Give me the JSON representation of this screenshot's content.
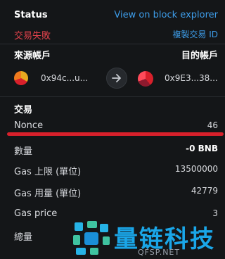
{
  "header": {
    "status_label": "Status",
    "explorer_link": "View on block explorer",
    "status_value": "交易失敗",
    "copy_tx_id": "複製交易 ID"
  },
  "accounts": {
    "from_label": "來源帳戶",
    "to_label": "目的帳戶",
    "from_address": "0x94c...u...",
    "to_address": "0x9E3...38..."
  },
  "transaction": {
    "section_label": "交易",
    "nonce_label": "Nonce",
    "nonce_value": "46",
    "amount_label": "數量",
    "amount_value": "-0 BNB",
    "gas_limit_label": "Gas 上限 (單位)",
    "gas_limit_value": "13500000",
    "gas_used_label": "Gas 用量 (單位)",
    "gas_used_value": "42779",
    "gas_price_label": "Gas price",
    "gas_price_value": "3",
    "total_label": "總量"
  },
  "watermark": {
    "brand": "量链科技",
    "domain": "QFSP.NET"
  },
  "colors": {
    "accent_blue": "#3d9ce8",
    "error_red": "#e2424b",
    "highlight_red": "#d8202b",
    "background": "#141618"
  }
}
